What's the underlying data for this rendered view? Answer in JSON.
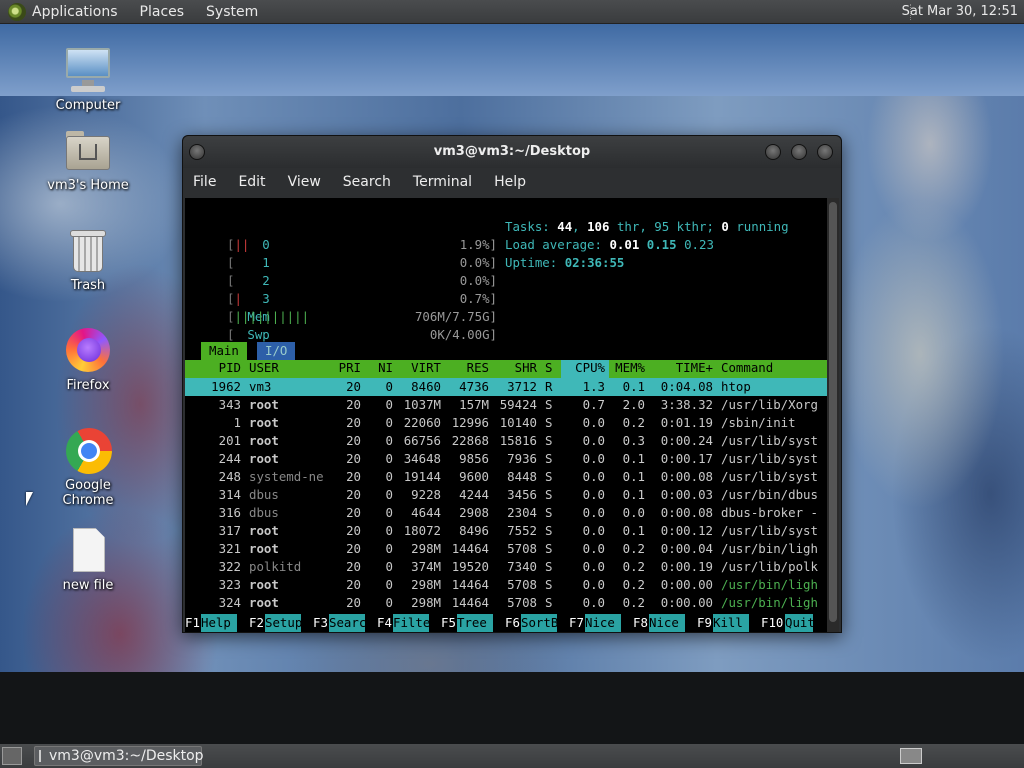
{
  "top_panel": {
    "menus": [
      "Applications",
      "Places",
      "System"
    ],
    "clock": "Sat Mar 30, 12:51"
  },
  "desktop_icons": [
    {
      "label": "Computer",
      "icon": "computer-icon"
    },
    {
      "label": "vm3's Home",
      "icon": "home-folder-icon"
    },
    {
      "label": "Trash",
      "icon": "trash-icon"
    },
    {
      "label": "Firefox",
      "icon": "firefox-icon"
    },
    {
      "label": "Google Chrome",
      "icon": "chrome-icon"
    },
    {
      "label": "new file",
      "icon": "file-icon"
    }
  ],
  "terminal": {
    "title": "vm3@vm3:~/Desktop",
    "menu": [
      "File",
      "Edit",
      "View",
      "Search",
      "Terminal",
      "Help"
    ],
    "htop": {
      "cpus": [
        {
          "id": "0",
          "bar": "||",
          "pct": "1.9%]"
        },
        {
          "id": "1",
          "bar": "",
          "pct": "0.0%]"
        },
        {
          "id": "2",
          "bar": "",
          "pct": "0.0%]"
        },
        {
          "id": "3",
          "bar": "|",
          "pct": "0.7%]"
        }
      ],
      "mem": {
        "label": "Mem",
        "bar": "||||||||||",
        "value": "706M/7.75G]"
      },
      "swp": {
        "label": "Swp",
        "bar": "",
        "value": "0K/4.00G]"
      },
      "tasks_label": "Tasks:",
      "tasks": "44",
      "thr": "106",
      "thr_label": "thr,",
      "kthr": "95 kthr;",
      "running": "0",
      "running_label": "running",
      "load_label": "Load average:",
      "load1": "0.01",
      "load5": "0.15",
      "load15": "0.23",
      "uptime_label": "Uptime:",
      "uptime": "02:36:55",
      "tabs": [
        "Main",
        "I/O"
      ],
      "columns": [
        "PID",
        "USER",
        "PRI",
        "NI",
        "VIRT",
        "RES",
        "SHR",
        "S",
        "CPU%",
        "MEM%",
        "TIME+",
        "Command"
      ],
      "processes": [
        {
          "pid": "1962",
          "user": "vm3",
          "pri": "20",
          "ni": "0",
          "virt": "8460",
          "res": "4736",
          "shr": "3712",
          "s": "R",
          "cpu": "1.3",
          "mem": "0.1",
          "time": "0:04.08",
          "cmd": "htop"
        },
        {
          "pid": "343",
          "user": "root",
          "pri": "20",
          "ni": "0",
          "virt": "1037M",
          "res": "157M",
          "shr": "59424",
          "s": "S",
          "cpu": "0.7",
          "mem": "2.0",
          "time": "3:38.32",
          "cmd": "/usr/lib/Xorg"
        },
        {
          "pid": "1",
          "user": "root",
          "pri": "20",
          "ni": "0",
          "virt": "22060",
          "res": "12996",
          "shr": "10140",
          "s": "S",
          "cpu": "0.0",
          "mem": "0.2",
          "time": "0:01.19",
          "cmd": "/sbin/init"
        },
        {
          "pid": "201",
          "user": "root",
          "pri": "20",
          "ni": "0",
          "virt": "66756",
          "res": "22868",
          "shr": "15816",
          "s": "S",
          "cpu": "0.0",
          "mem": "0.3",
          "time": "0:00.24",
          "cmd": "/usr/lib/syst"
        },
        {
          "pid": "244",
          "user": "root",
          "pri": "20",
          "ni": "0",
          "virt": "34648",
          "res": "9856",
          "shr": "7936",
          "s": "S",
          "cpu": "0.0",
          "mem": "0.1",
          "time": "0:00.17",
          "cmd": "/usr/lib/syst"
        },
        {
          "pid": "248",
          "user": "systemd-ne",
          "pri": "20",
          "ni": "0",
          "virt": "19144",
          "res": "9600",
          "shr": "8448",
          "s": "S",
          "cpu": "0.0",
          "mem": "0.1",
          "time": "0:00.08",
          "cmd": "/usr/lib/syst"
        },
        {
          "pid": "314",
          "user": "dbus",
          "pri": "20",
          "ni": "0",
          "virt": "9228",
          "res": "4244",
          "shr": "3456",
          "s": "S",
          "cpu": "0.0",
          "mem": "0.1",
          "time": "0:00.03",
          "cmd": "/usr/bin/dbus"
        },
        {
          "pid": "316",
          "user": "dbus",
          "pri": "20",
          "ni": "0",
          "virt": "4644",
          "res": "2908",
          "shr": "2304",
          "s": "S",
          "cpu": "0.0",
          "mem": "0.0",
          "time": "0:00.08",
          "cmd": "dbus-broker -"
        },
        {
          "pid": "317",
          "user": "root",
          "pri": "20",
          "ni": "0",
          "virt": "18072",
          "res": "8496",
          "shr": "7552",
          "s": "S",
          "cpu": "0.0",
          "mem": "0.1",
          "time": "0:00.12",
          "cmd": "/usr/lib/syst"
        },
        {
          "pid": "321",
          "user": "root",
          "pri": "20",
          "ni": "0",
          "virt": "298M",
          "res": "14464",
          "shr": "5708",
          "s": "S",
          "cpu": "0.0",
          "mem": "0.2",
          "time": "0:00.04",
          "cmd": "/usr/bin/ligh"
        },
        {
          "pid": "322",
          "user": "polkitd",
          "pri": "20",
          "ni": "0",
          "virt": "374M",
          "res": "19520",
          "shr": "7340",
          "s": "S",
          "cpu": "0.0",
          "mem": "0.2",
          "time": "0:00.19",
          "cmd": "/usr/lib/polk"
        },
        {
          "pid": "323",
          "user": "root",
          "pri": "20",
          "ni": "0",
          "virt": "298M",
          "res": "14464",
          "shr": "5708",
          "s": "S",
          "cpu": "0.0",
          "mem": "0.2",
          "time": "0:00.00",
          "cmd": "/usr/bin/ligh"
        },
        {
          "pid": "324",
          "user": "root",
          "pri": "20",
          "ni": "0",
          "virt": "298M",
          "res": "14464",
          "shr": "5708",
          "s": "S",
          "cpu": "0.0",
          "mem": "0.2",
          "time": "0:00.00",
          "cmd": "/usr/bin/ligh"
        }
      ],
      "fkeys": [
        {
          "key": "F1",
          "label": "Help"
        },
        {
          "key": "F2",
          "label": "Setup"
        },
        {
          "key": "F3",
          "label": "Search"
        },
        {
          "key": "F4",
          "label": "Filter"
        },
        {
          "key": "F5",
          "label": "Tree"
        },
        {
          "key": "F6",
          "label": "SortBy"
        },
        {
          "key": "F7",
          "label": "Nice -"
        },
        {
          "key": "F8",
          "label": "Nice +"
        },
        {
          "key": "F9",
          "label": "Kill"
        },
        {
          "key": "F10",
          "label": "Quit"
        }
      ]
    }
  },
  "taskbar": {
    "task_label": "vm3@vm3:~/Desktop"
  },
  "colors": {
    "htop_header": "#4caf22",
    "htop_selected": "#3fb8b8",
    "htop_fkey_label": "#2aa3a3"
  }
}
